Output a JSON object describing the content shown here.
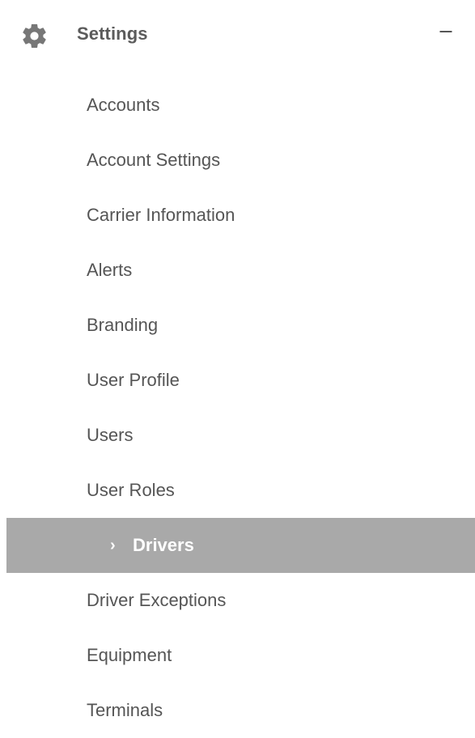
{
  "header": {
    "title": "Settings",
    "icon": "gear-icon",
    "collapse_symbol": "–"
  },
  "items": [
    {
      "label": "Accounts"
    },
    {
      "label": "Account Settings"
    },
    {
      "label": "Carrier Information"
    },
    {
      "label": "Alerts"
    },
    {
      "label": "Branding"
    },
    {
      "label": "User Profile"
    },
    {
      "label": "Users"
    },
    {
      "label": "User Roles"
    },
    {
      "label": "Drivers",
      "active": true
    },
    {
      "label": "Driver Exceptions"
    },
    {
      "label": "Equipment"
    },
    {
      "label": "Terminals"
    }
  ],
  "colors": {
    "text": "#555555",
    "active_background": "#a9a9a9",
    "active_text": "#ffffff"
  }
}
